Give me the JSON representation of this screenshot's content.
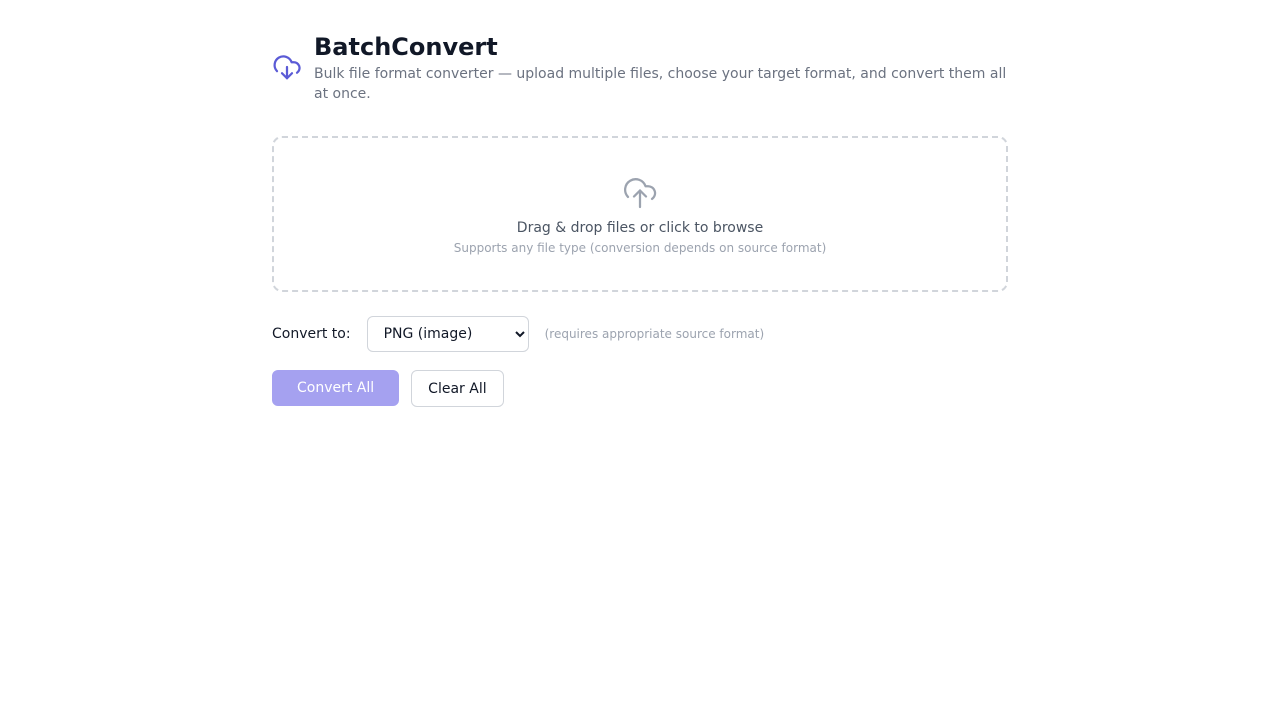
{
  "app": {
    "title": "BatchConvert",
    "subtitle": "Bulk file format converter — upload multiple files, choose your target format, and convert them all at once.",
    "logo_icon": "cloud-download-icon",
    "accent_color": "#5b5bd6"
  },
  "dropzone": {
    "icon": "cloud-upload-icon",
    "text": "Drag & drop files or click to browse",
    "subtext": "Supports any file type (conversion depends on source format)"
  },
  "convert": {
    "label": "Convert to:",
    "selected": "PNG (image)",
    "options": [
      "PNG (image)"
    ],
    "hint": "(requires appropriate source format)"
  },
  "actions": {
    "convert_all": "Convert All",
    "clear_all": "Clear All",
    "convert_all_color": "#a5a1f0"
  }
}
